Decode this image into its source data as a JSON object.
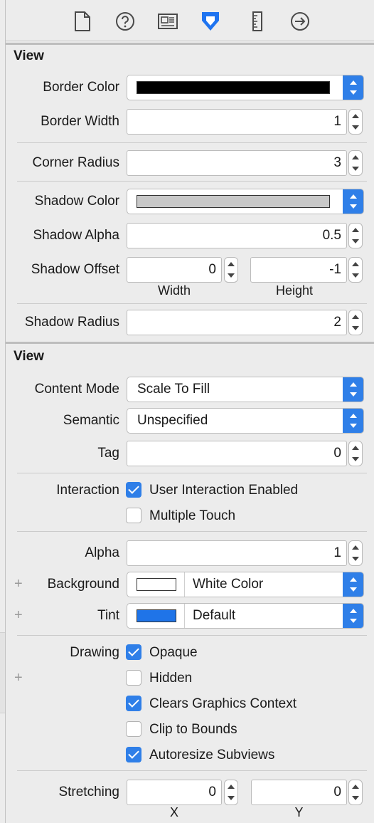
{
  "toolbar": {
    "icons": [
      "file-icon",
      "help-icon",
      "identity-icon",
      "attributes-icon",
      "size-ruler-icon",
      "connections-icon"
    ],
    "active_color": "#1f74f0"
  },
  "runtime_section": {
    "title": "View",
    "border_color": {
      "label": "Border Color",
      "swatch": "#000000"
    },
    "border_width": {
      "label": "Border Width",
      "value": "1"
    },
    "corner_radius": {
      "label": "Corner Radius",
      "value": "3"
    },
    "shadow_color": {
      "label": "Shadow Color",
      "swatch": "#c8c8c8"
    },
    "shadow_alpha": {
      "label": "Shadow Alpha",
      "value": "0.5"
    },
    "shadow_offset": {
      "label": "Shadow Offset",
      "width": "0",
      "height": "-1",
      "width_label": "Width",
      "height_label": "Height"
    },
    "shadow_radius": {
      "label": "Shadow Radius",
      "value": "2"
    }
  },
  "view_section": {
    "title": "View",
    "content_mode": {
      "label": "Content Mode",
      "value": "Scale To Fill"
    },
    "semantic": {
      "label": "Semantic",
      "value": "Unspecified"
    },
    "tag": {
      "label": "Tag",
      "value": "0"
    },
    "interaction": {
      "label": "Interaction",
      "user_interaction_enabled": {
        "label": "User Interaction Enabled",
        "checked": true
      },
      "multiple_touch": {
        "label": "Multiple Touch",
        "checked": false
      }
    },
    "alpha": {
      "label": "Alpha",
      "value": "1"
    },
    "background": {
      "label": "Background",
      "value": "White Color",
      "swatch": "#ffffff"
    },
    "tint": {
      "label": "Tint",
      "value": "Default",
      "swatch": "#1f74e8"
    },
    "drawing": {
      "label": "Drawing",
      "opaque": {
        "label": "Opaque",
        "checked": true
      },
      "hidden": {
        "label": "Hidden",
        "checked": false
      },
      "clears_graphics_context": {
        "label": "Clears Graphics Context",
        "checked": true
      },
      "clip_to_bounds": {
        "label": "Clip to Bounds",
        "checked": false
      },
      "autoresize_subviews": {
        "label": "Autoresize Subviews",
        "checked": true
      }
    },
    "stretching": {
      "label": "Stretching",
      "x": "0",
      "y": "0",
      "x_label": "X",
      "y_label": "Y"
    }
  },
  "accent_color": "#2f7fe8"
}
